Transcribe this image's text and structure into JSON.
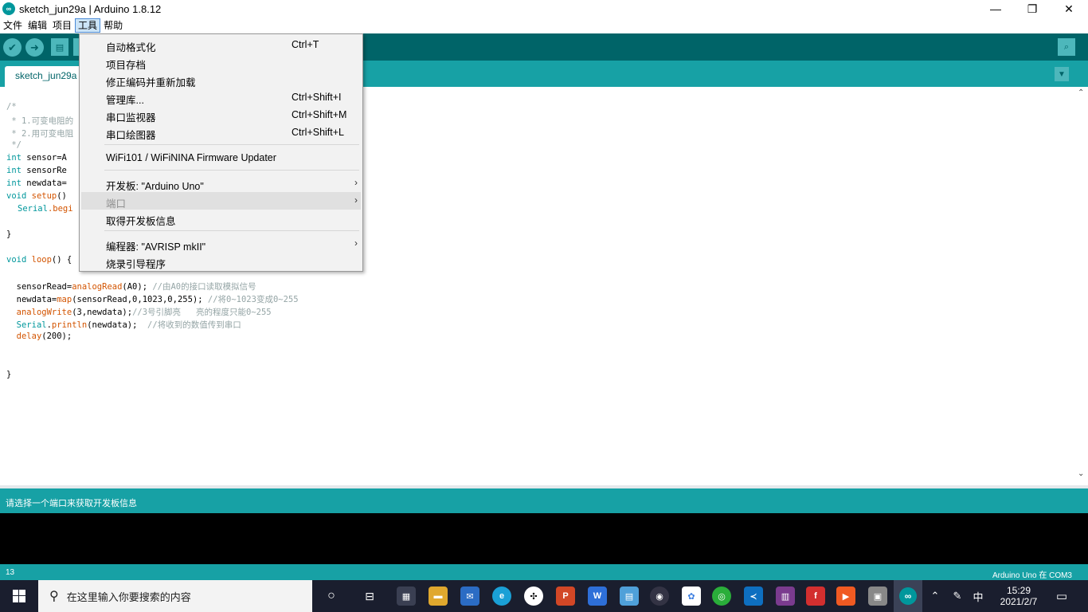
{
  "window": {
    "title": "sketch_jun29a | Arduino 1.8.12"
  },
  "menubar": {
    "items": [
      "文件",
      "编辑",
      "项目",
      "工具",
      "帮助"
    ],
    "active_index": 3
  },
  "tab": {
    "label": "sketch_jun29a"
  },
  "tools_menu": {
    "items": [
      {
        "label": "自动格式化",
        "shortcut": "Ctrl+T"
      },
      {
        "label": "项目存档",
        "shortcut": ""
      },
      {
        "label": "修正编码并重新加载",
        "shortcut": ""
      },
      {
        "label": "管理库...",
        "shortcut": "Ctrl+Shift+I"
      },
      {
        "label": "串口监视器",
        "shortcut": "Ctrl+Shift+M"
      },
      {
        "label": "串口绘图器",
        "shortcut": "Ctrl+Shift+L"
      },
      {
        "label": "WiFi101 / WiFiNINA Firmware Updater",
        "shortcut": ""
      },
      {
        "label": "开发板: \"Arduino Uno\"",
        "shortcut": "",
        "submenu": true
      },
      {
        "label": "端口",
        "shortcut": "",
        "submenu": true,
        "disabled": true
      },
      {
        "label": "取得开发板信息",
        "shortcut": ""
      },
      {
        "label": "编程器: \"AVRISP mkII\"",
        "shortcut": "",
        "submenu": true
      },
      {
        "label": "烧录引导程序",
        "shortcut": ""
      }
    ]
  },
  "code": {
    "l1": "/*",
    "l2": " * 1.可变电阻的",
    "l3": " * 2.用可变电阻",
    "l4": " */",
    "l5a": "int",
    "l5b": " sensor=A",
    "l6a": "int",
    "l6b": " sensorRe",
    "l7a": "int",
    "l7b": " newdata=",
    "l8a": "void",
    "l8b": " setup",
    "l8c": "() ",
    "l9a": "Serial",
    "l9b": ".begi",
    "l11": "}",
    "l13a": "void",
    "l13b": " loop",
    "l13c": "() {",
    "l15a": "  sensorRead=",
    "l15b": "analogRead",
    "l15c": "(A0); ",
    "l15d": "//由A0的接口读取模拟信号",
    "l16a": "  newdata=",
    "l16b": "map",
    "l16c": "(sensorRead,0,1023,0,255); ",
    "l16d": "//将0~1023变成0~255",
    "l17a": "  ",
    "l17b": "analogWrite",
    "l17c": "(3,newdata);",
    "l17d": "//3号引脚亮   亮的程度只能0~255",
    "l18a": "  ",
    "l18b": "Serial",
    "l18c": ".",
    "l18d": "println",
    "l18e": "(newdata);  ",
    "l18f": "//将收到的数值传到串口",
    "l19a": "  ",
    "l19b": "delay",
    "l19c": "(200);",
    "l22": "}"
  },
  "status": {
    "message": "请选择一个端口来获取开发板信息"
  },
  "bottom": {
    "line": "13",
    "board": "Arduino Uno 在 COM3"
  },
  "taskbar": {
    "search_placeholder": "在这里输入你要搜索的内容",
    "ime": "中",
    "time": "15:29",
    "date": "2021/2/7"
  }
}
